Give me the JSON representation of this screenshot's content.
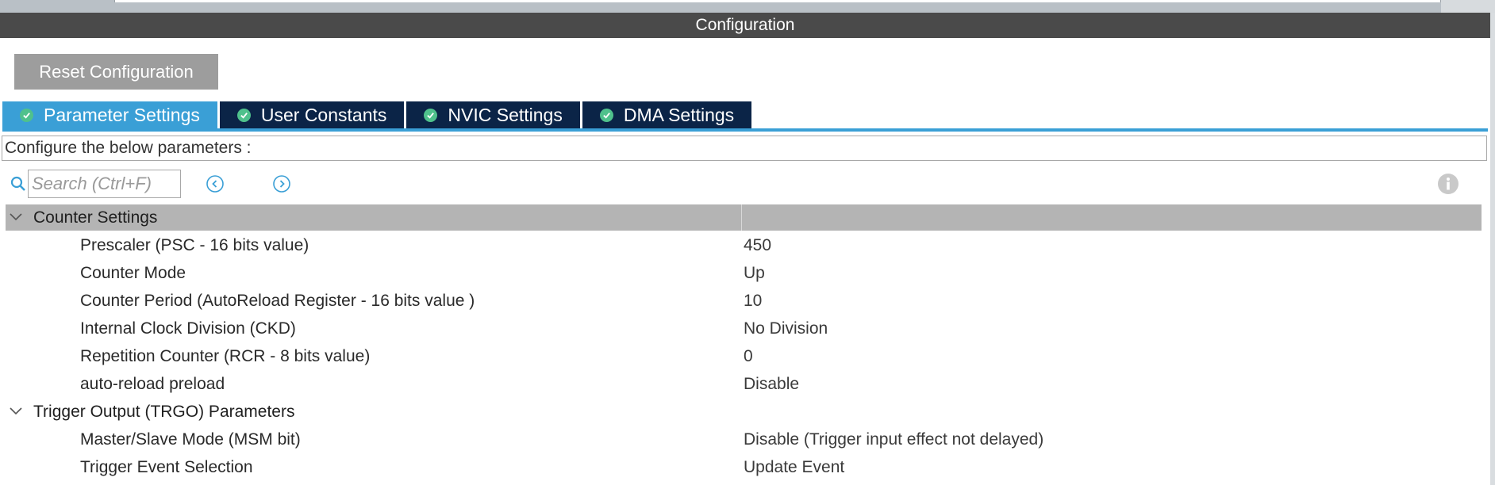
{
  "header": {
    "title": "Configuration"
  },
  "reset_button": "Reset Configuration",
  "tabs": [
    {
      "label": "Parameter Settings",
      "active": true
    },
    {
      "label": "User Constants",
      "active": false
    },
    {
      "label": "NVIC Settings",
      "active": false
    },
    {
      "label": "DMA Settings",
      "active": false
    }
  ],
  "description": "Configure the below parameters :",
  "search": {
    "placeholder": "Search (Ctrl+F)",
    "value": ""
  },
  "sections": [
    {
      "title": "Counter Settings",
      "rows": [
        {
          "label": "Prescaler (PSC - 16 bits value)",
          "value": "450"
        },
        {
          "label": "Counter Mode",
          "value": "Up"
        },
        {
          "label": "Counter Period (AutoReload Register - 16 bits value )",
          "value": "10"
        },
        {
          "label": "Internal Clock Division (CKD)",
          "value": "No Division"
        },
        {
          "label": "Repetition Counter (RCR - 8 bits value)",
          "value": "0"
        },
        {
          "label": "auto-reload preload",
          "value": "Disable"
        }
      ]
    },
    {
      "title": "Trigger Output (TRGO) Parameters",
      "rows": [
        {
          "label": "Master/Slave Mode (MSM bit)",
          "value": "Disable (Trigger input effect not delayed)"
        },
        {
          "label": "Trigger Event Selection",
          "value": "Update Event"
        }
      ]
    }
  ],
  "colors": {
    "header_bg": "#4a4a4a",
    "tab_active": "#3a9fd6",
    "tab_inactive": "#0b2447",
    "check_green": "#4fc18c",
    "section_bg": "#b4b4b4"
  }
}
